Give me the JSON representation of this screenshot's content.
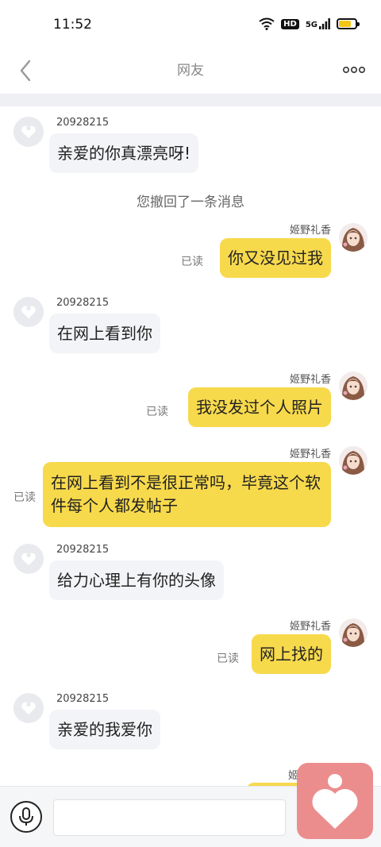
{
  "status_bar": {
    "time": "11:52",
    "hd": "HD",
    "network": "5G",
    "battery_level": 0.75,
    "battery_color": "#f3c518"
  },
  "header": {
    "title": "网友",
    "back_icon": "chevron-left-icon",
    "more_icon": "more-dots-icon"
  },
  "colors": {
    "outgoing_bubble": "#f7d94c",
    "incoming_bubble": "#f3f4f7",
    "separator": "#eef0f4",
    "floating_button": "#ec8d8d"
  },
  "messages": [
    {
      "direction": "in",
      "sender": "20928215",
      "text": "亲爱的你真漂亮呀!"
    },
    {
      "direction": "system",
      "text": "您撤回了一条消息"
    },
    {
      "direction": "out",
      "sender": "姬野礼香",
      "text": "你又没见过我",
      "status": "已读"
    },
    {
      "direction": "in",
      "sender": "20928215",
      "text": "在网上看到你"
    },
    {
      "direction": "out",
      "sender": "姬野礼香",
      "text": "我没发过个人照片",
      "status": "已读"
    },
    {
      "direction": "out",
      "sender": "姬野礼香",
      "text": "在网上看到不是很正常吗，毕竟这个软件每个人都发帖子",
      "status": "已读"
    },
    {
      "direction": "in",
      "sender": "20928215",
      "text": "给力心理上有你的头像"
    },
    {
      "direction": "out",
      "sender": "姬野礼香",
      "text": "网上找的",
      "status": "已读"
    },
    {
      "direction": "in",
      "sender": "20928215",
      "text": "亲爱的我爱你"
    },
    {
      "direction": "out",
      "sender": "姬",
      "text": ""
    }
  ],
  "input_bar": {
    "placeholder": "",
    "value": "",
    "mic_icon": "microphone-icon"
  },
  "floating_button": {
    "icon": "heart-person-icon"
  }
}
